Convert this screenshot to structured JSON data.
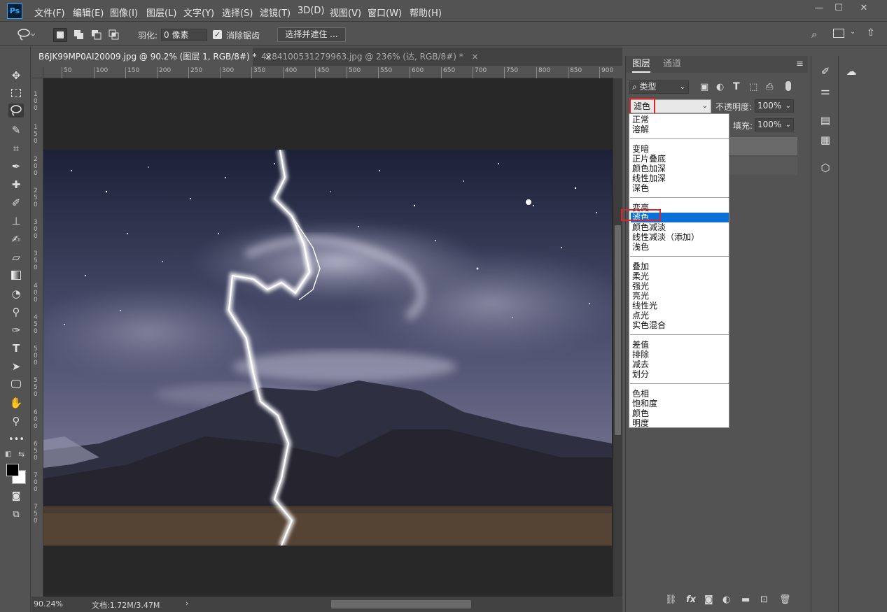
{
  "app": {
    "logo": "Ps"
  },
  "menu": [
    "文件(F)",
    "编辑(E)",
    "图像(I)",
    "图层(L)",
    "文字(Y)",
    "选择(S)",
    "滤镜(T)",
    "3D(D)",
    "视图(V)",
    "窗口(W)",
    "帮助(H)"
  ],
  "window_controls": {
    "minimize": "—",
    "maximize": "☐",
    "close": "✕"
  },
  "options": {
    "feather_label": "羽化:",
    "feather_value": "0 像素",
    "antialias_label": "消除锯齿",
    "antialias_checked": true,
    "select_mask_button": "选择并遮住 ..."
  },
  "tabs": [
    {
      "label": "B6JK99MP0AI20009.jpg @ 90.2% (图层 1, RGB/8#) *",
      "close": "×",
      "active": true
    },
    {
      "label": "4284100531279963.jpg @ 236% (达, RGB/8#) *",
      "close": "×",
      "active": false
    }
  ],
  "ruler_h": [
    "50",
    "100",
    "150",
    "200",
    "250",
    "300",
    "350",
    "400",
    "450",
    "500",
    "550",
    "600",
    "650",
    "700",
    "750",
    "800",
    "850",
    "900"
  ],
  "ruler_v": [
    "1\n0\n0",
    "1\n5\n0",
    "2\n0\n0",
    "2\n5\n0",
    "3\n0\n0",
    "3\n5\n0",
    "4\n0\n0",
    "4\n5\n0",
    "5\n0\n0",
    "5\n5\n0",
    "6\n0\n0",
    "6\n5\n0",
    "7\n0\n0",
    "7\n5\n0"
  ],
  "status": {
    "zoom": "90.24%",
    "doc": "文档:1.72M/3.47M",
    "arrow": "›"
  },
  "layers_panel": {
    "tabs": [
      "图层",
      "通道"
    ],
    "filter_kind": "类型",
    "blend_mode": "滤色",
    "opacity_label": "不透明度:",
    "opacity_value": "100%",
    "fill_label": "填充:",
    "fill_value": "100%",
    "footer_icons": [
      "link-icon",
      "fx-icon",
      "mask-icon",
      "adjustment-icon",
      "folder-icon",
      "new-layer-icon",
      "trash-icon"
    ]
  },
  "blend_groups": [
    [
      "正常",
      "溶解"
    ],
    [
      "变暗",
      "正片叠底",
      "颜色加深",
      "线性加深",
      "深色"
    ],
    [
      "变亮",
      "滤色",
      "颜色减淡",
      "线性减淡（添加）",
      "浅色"
    ],
    [
      "叠加",
      "柔光",
      "强光",
      "亮光",
      "线性光",
      "点光",
      "实色混合"
    ],
    [
      "差值",
      "排除",
      "减去",
      "划分"
    ],
    [
      "色相",
      "饱和度",
      "颜色",
      "明度"
    ]
  ],
  "selected_blend": "滤色",
  "colors": {
    "ui_bg": "#535353",
    "canvas_bg": "#282828",
    "selection": "#0a6fd6",
    "highlight_box": "#e0242a",
    "ps_blue": "#31a8ff"
  }
}
